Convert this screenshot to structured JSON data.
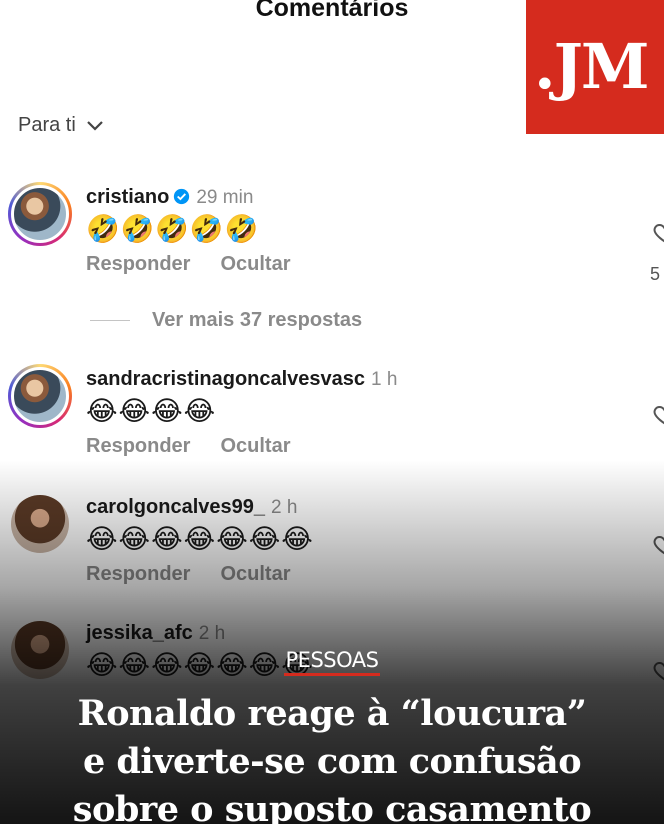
{
  "header": {
    "title": "Comentários"
  },
  "logo": {
    "text": ".JM"
  },
  "sort": {
    "label": "Para ti"
  },
  "comments": [
    {
      "username": "cristiano",
      "verified": true,
      "time": "29 min",
      "emojis": "🤣🤣🤣🤣🤣",
      "reply": "Responder",
      "hide": "Ocultar",
      "likes": "5"
    },
    {
      "username": "sandracristinagoncalvesvasc",
      "time": "1 h",
      "emojis": "😂😂😂😂",
      "reply": "Responder",
      "hide": "Ocultar"
    },
    {
      "username": "carolgoncalves99_",
      "time": "2 h",
      "emojis": "😂😂😂😂😂😂😂",
      "reply": "Responder",
      "hide": "Ocultar"
    },
    {
      "username": "jessika_afc",
      "time": "2 h",
      "emojis": "😂😂😂😂😂😂😂"
    }
  ],
  "more_replies": "Ver mais 37 respostas",
  "news": {
    "kicker": "PESSOAS",
    "headline_lines": [
      "Ronaldo reage à “loucura”",
      "e diverte-se com confusão",
      "sobre o suposto casamento"
    ]
  },
  "colors": {
    "brand_red": "#d52b1e",
    "verified_blue": "#0095f6"
  }
}
